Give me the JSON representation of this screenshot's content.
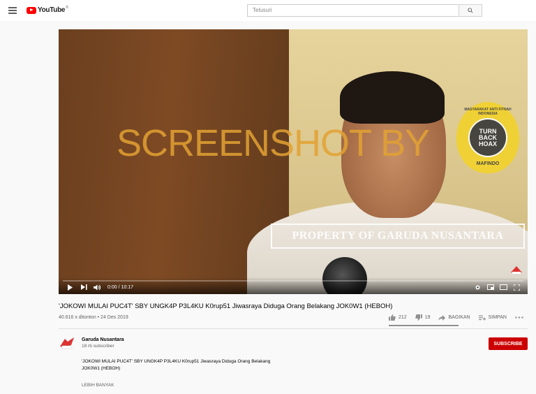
{
  "header": {
    "logo_text": "YouTube",
    "logo_reg": "®",
    "search_placeholder": "Telusuri",
    "search_icon": "search-icon",
    "menu_icon": "menu-icon"
  },
  "player": {
    "watermark_text": "SCREENSHOT BY",
    "badge_top": "MASYARAKAT ANTI FITNAH INDONESIA",
    "badge_line1": "TURN",
    "badge_line2": "BACK",
    "badge_line3": "HOAX",
    "badge_bottom": "MAFINDO",
    "property_text": "PROPERTY OF GARUDA NUSANTARA",
    "time": "0:00 / 10:17",
    "progress": 0,
    "colors": {
      "progress": "#ff0000",
      "watermark": "#e3a233",
      "badge": "#f2d22e"
    }
  },
  "video": {
    "title": "'JOKOWI MULAI PUC4T' SBY UNGK4P P3L4KU K0rup51 Jiwasraya Diduga Orang Belakang JOK0W1 (HEBOH)",
    "views_date": "40.616 x ditonton • 24 Des 2019",
    "likes": "212",
    "dislikes": "19",
    "share_label": "BAGIKAN",
    "save_label": "SIMPAN",
    "more_icon": "more-icon"
  },
  "channel": {
    "name": "Garuda Nusantara",
    "subscribers": "18 rb subscriber",
    "subscribe_label": "SUBSCRIBE",
    "description_line1": "'JOKOWI MULAI PUC4T' SBY UNGK4P P3L4KU K0rup51 Jiwasraya Diduga Orang Belakang",
    "description_line2": "JOK0W1 (HEBOH)",
    "show_more": "LEBIH BANYAK",
    "brand_color": "#cc0000"
  }
}
